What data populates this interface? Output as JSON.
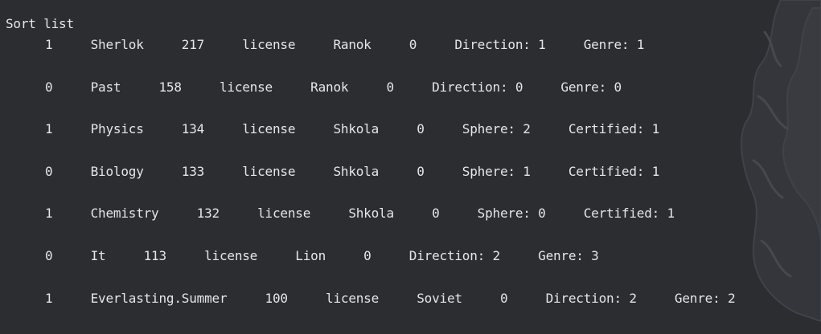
{
  "console": {
    "title": "Sort list",
    "rows": [
      "1     Sherlok     217     license     Ranok     0     Direction: 1     Genre: 1",
      "0     Past     158     license     Ranok     0     Direction: 0     Genre: 0",
      "1     Physics     134     license     Shkola     0     Sphere: 2     Certified: 1",
      "0     Biology     133     license     Shkola     0     Sphere: 1     Certified: 1",
      "1     Chemistry     132     license     Shkola     0     Sphere: 0     Certified: 1",
      "0     It     113     license     Lion     0     Direction: 2     Genre: 3",
      "1     Everlasting.Summer     100     license     Soviet     0     Direction: 2     Genre: 2"
    ]
  },
  "colors": {
    "background": "#2b2d31",
    "text": "#e4e6ea",
    "art": "#3a3c42"
  },
  "background_art": "dragon-silhouette-art"
}
